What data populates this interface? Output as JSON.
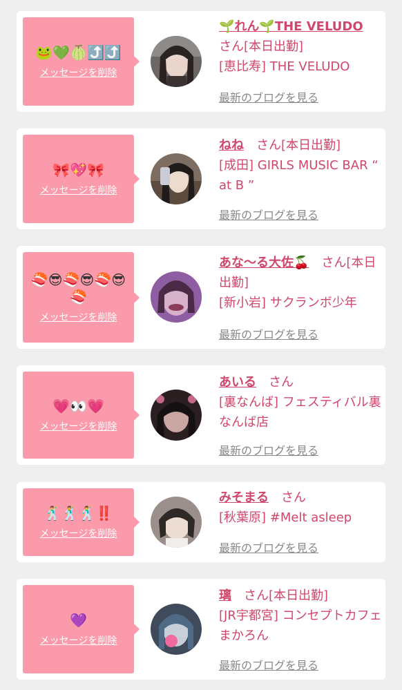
{
  "delete_label": "メッセージを削除",
  "blog_label": "最新のブログを見る",
  "items": [
    {
      "message": "🐸💚🍈⤴️⤴️",
      "name": "🌱れん🌱THE VELUDO",
      "suffix": "さん[本日出勤]",
      "shop": "[恵比寿] THE VELUDO"
    },
    {
      "message": "🎀💖🎀",
      "name": "ねね",
      "suffix": "さん[本日出勤]",
      "shop": "[成田] GIRLS MUSIC BAR “ at B ”"
    },
    {
      "message": "🍣😎🍣😎🍣😎🍣",
      "name": "あな〜る大佐🍒",
      "suffix": "さん[本日出勤]",
      "shop": "[新小岩] サクランボ少年"
    },
    {
      "message": "💗👀💗",
      "name": "あいる",
      "suffix": "さん",
      "shop": "[裏なんば] フェスティバル裏なんば店"
    },
    {
      "message": "🕺🕺🕺‼️",
      "name": "みそまる",
      "suffix": "さん",
      "shop": "[秋葉原] #Melt asleep"
    },
    {
      "message": "💜",
      "name": "璃",
      "suffix": "さん[本日出勤]",
      "shop": "[JR宇都宮] コンセプトカフェ まかろん"
    }
  ],
  "colors": {
    "accent": "#d1466b",
    "bubble": "#fb9aaa",
    "link_gray": "#888888",
    "background": "#efefef"
  }
}
